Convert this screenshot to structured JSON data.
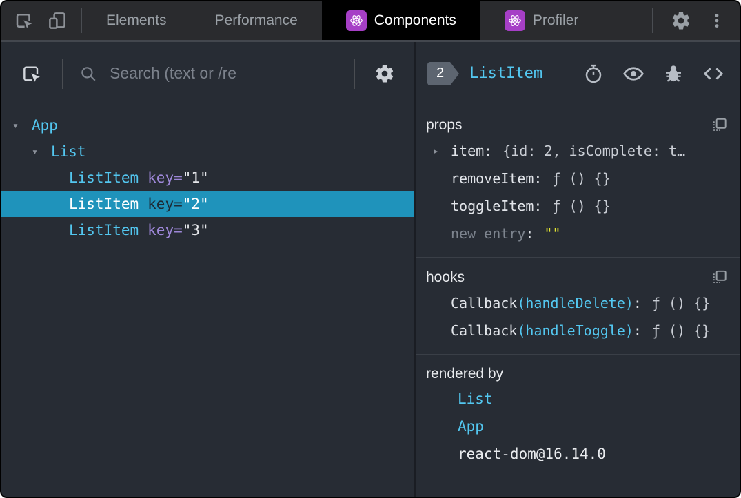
{
  "colors": {
    "accent_cyan": "#53c7f0",
    "selected_row_bg": "#1f93bb",
    "key_purple": "#9d87d8",
    "string_yellow": "#e7e831",
    "react_icon_bg": "#a63fc6",
    "active_tab_bg": "#000000"
  },
  "toolbar": {
    "tabs": [
      {
        "label": "Elements",
        "active": false
      },
      {
        "label": "Performance",
        "active": false
      },
      {
        "label": "Components",
        "active": true
      },
      {
        "label": "Profiler",
        "active": false
      }
    ]
  },
  "left_panel": {
    "search": {
      "placeholder": "Search (text or /re"
    },
    "attr_equals": "=",
    "tree": {
      "items": [
        {
          "name": "App",
          "depth": 0,
          "expanded": true,
          "selected": false
        },
        {
          "name": "List",
          "depth": 1,
          "expanded": true,
          "selected": false
        },
        {
          "name": "ListItem",
          "key_name": "key",
          "key_value": "\"1\"",
          "depth": 2,
          "selected": false
        },
        {
          "name": "ListItem",
          "key_name": "key",
          "key_value": "\"2\"",
          "depth": 2,
          "selected": true
        },
        {
          "name": "ListItem",
          "key_name": "key",
          "key_value": "\"3\"",
          "depth": 2,
          "selected": false
        }
      ]
    }
  },
  "right_panel": {
    "header": {
      "badge": "2",
      "title": "ListItem"
    },
    "props": {
      "title": "props",
      "rows": [
        {
          "name": "item",
          "colon": ":",
          "value": "{id: 2, isComplete: t…",
          "expandable": true
        },
        {
          "name": "removeItem",
          "colon": ":",
          "value": "ƒ () {}"
        },
        {
          "name": "toggleItem",
          "colon": ":",
          "value": "ƒ () {}"
        },
        {
          "name": "new entry",
          "colon": ":",
          "value": "\"\""
        }
      ]
    },
    "hooks": {
      "title": "hooks",
      "rows": [
        {
          "name": "Callback",
          "arg": "(handleDelete)",
          "colon": ":",
          "value": "ƒ () {}"
        },
        {
          "name": "Callback",
          "arg": "(handleToggle)",
          "colon": ":",
          "value": "ƒ () {}"
        }
      ]
    },
    "rendered_by": {
      "title": "rendered by",
      "items": [
        {
          "label": "List"
        },
        {
          "label": "App"
        },
        {
          "label": "react-dom@16.14.0"
        }
      ]
    }
  }
}
